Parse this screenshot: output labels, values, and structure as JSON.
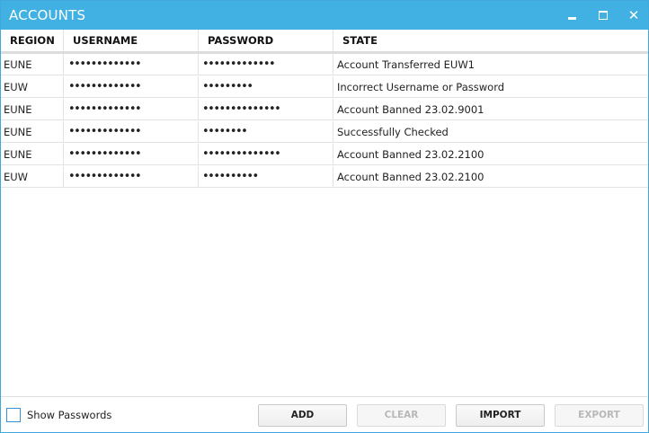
{
  "window": {
    "title": "ACCOUNTS",
    "accent_color": "#41b0e2"
  },
  "table": {
    "columns": [
      "REGION",
      "USERNAME",
      "PASSWORD",
      "STATE"
    ],
    "rows": [
      {
        "region": "EUNE",
        "username": "•••••••••••••",
        "password": "•••••••••••••",
        "state": "Account Transferred EUW1"
      },
      {
        "region": "EUW",
        "username": "•••••••••••••",
        "password": "•••••••••",
        "state": "Incorrect Username or Password"
      },
      {
        "region": "EUNE",
        "username": "•••••••••••••",
        "password": "••••••••••••••",
        "state": "Account Banned 23.02.9001"
      },
      {
        "region": "EUNE",
        "username": "•••••••••••••",
        "password": "••••••••",
        "state": "Successfully Checked"
      },
      {
        "region": "EUNE",
        "username": "•••••••••••••",
        "password": "••••••••••••••",
        "state": "Account Banned 23.02.2100"
      },
      {
        "region": "EUW",
        "username": "•••••••••••••",
        "password": "••••••••••",
        "state": "Account Banned 23.02.2100"
      }
    ]
  },
  "footer": {
    "show_passwords_label": "Show Passwords",
    "show_passwords_checked": false,
    "buttons": {
      "add": "ADD",
      "clear": "CLEAR",
      "import": "IMPORT",
      "export": "EXPORT"
    }
  }
}
